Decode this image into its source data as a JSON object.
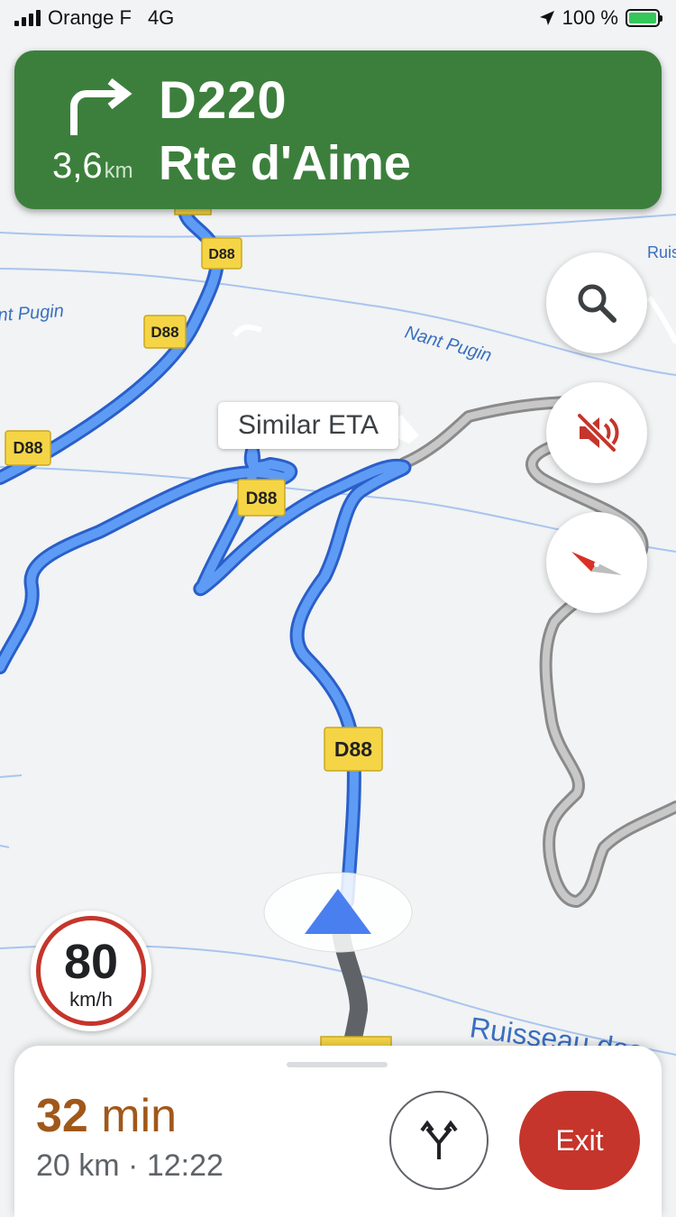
{
  "status_bar": {
    "carrier": "Orange F",
    "network": "4G",
    "battery": "100 %"
  },
  "nav_banner": {
    "road_number": "D220",
    "road_name": "Rte d'Aime",
    "distance_value": "3,6",
    "distance_unit": "km",
    "maneuver_icon": "turn-right-icon",
    "background_color": "#3c7f3c"
  },
  "map": {
    "road_shields": [
      "D88",
      "D88",
      "D88",
      "D88",
      "D88"
    ],
    "water_labels": [
      "nt Pugin",
      "Nant Pugin",
      "Ruisseau des",
      "Ruis"
    ],
    "callout": "Similar ETA",
    "route_color": "#4285f4",
    "alt_route_color": "#9e9e9e"
  },
  "controls": {
    "search_icon": "search-icon",
    "mute_icon": "volume-off-icon",
    "compass_icon": "compass-icon"
  },
  "speed_limit": {
    "value": "80",
    "unit": "km/h"
  },
  "bottom_panel": {
    "eta_number": "32",
    "eta_unit": "min",
    "distance": "20 km",
    "separator": "·",
    "arrival_time": "12:22",
    "routes_icon": "alternate-routes-icon",
    "exit_label": "Exit"
  }
}
